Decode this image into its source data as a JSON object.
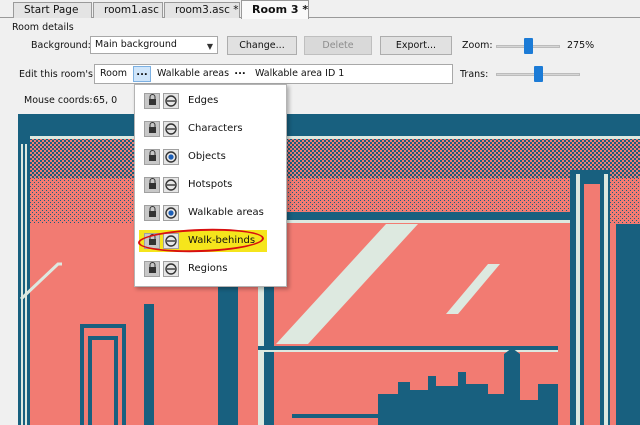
{
  "tabs": [
    {
      "label": "Start Page"
    },
    {
      "label": "room1.asc"
    },
    {
      "label": "room3.asc *"
    },
    {
      "label": "Room 3 *"
    }
  ],
  "room_details": {
    "group_label": "Room details",
    "background_label": "Background:",
    "background_value": "Main background",
    "change_button": "Change...",
    "delete_button": "Delete",
    "export_button": "Export...",
    "zoom_label": "Zoom:",
    "zoom_value": "275%",
    "zoom_level": 0.5,
    "edit_label": "Edit this room's:",
    "trans_label": "Trans:",
    "trans_level": 0.5,
    "path": {
      "room": "Room",
      "dots": "...",
      "layer": "Walkable areas",
      "item": "Walkable area ID 1"
    },
    "mouse_label": "Mouse coords:",
    "mouse_value": "65, 0"
  },
  "layer_menu": {
    "items": [
      {
        "label": "Edges",
        "eye": "hidden"
      },
      {
        "label": "Characters",
        "eye": "hidden"
      },
      {
        "label": "Objects",
        "eye": "visible"
      },
      {
        "label": "Hotspots",
        "eye": "hidden"
      },
      {
        "label": "Walkable areas",
        "eye": "visible"
      },
      {
        "label": "Walk-behinds",
        "eye": "hidden",
        "highlighted": true
      },
      {
        "label": "Regions",
        "eye": "hidden"
      }
    ]
  },
  "colors": {
    "canvas_salmon": "#f27b72",
    "canvas_teal": "#18607f",
    "canvas_light": "#dde9e0",
    "highlight_yellow": "#f5e51c",
    "annotation_red": "#d80f0f",
    "slider_accent": "#1c7bd6"
  }
}
